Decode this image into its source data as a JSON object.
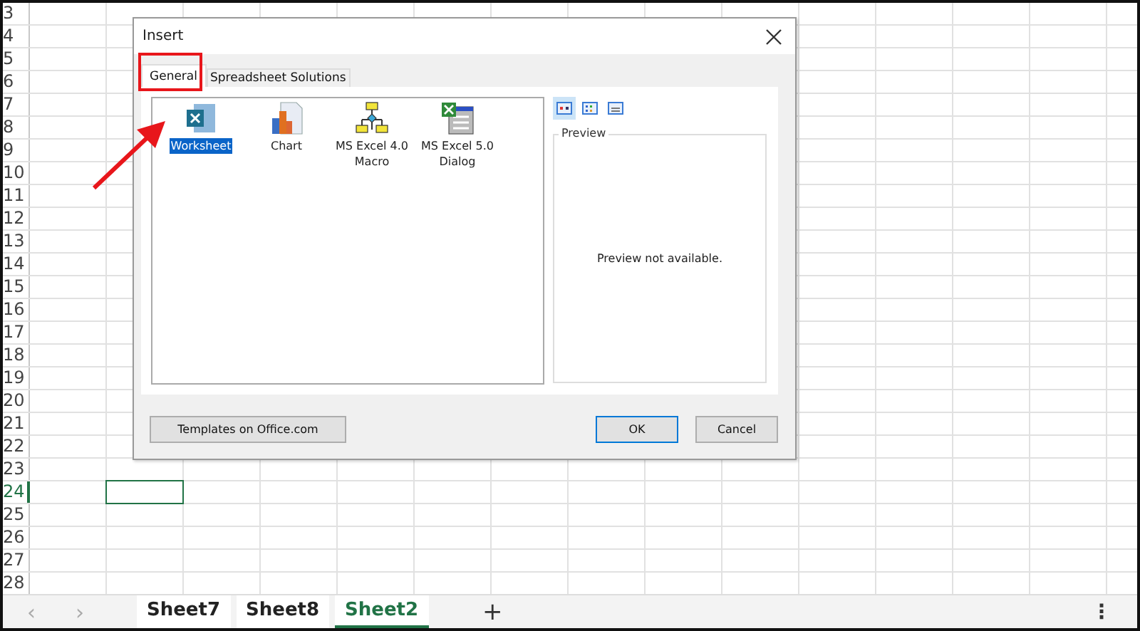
{
  "rows": [
    {
      "label": "3",
      "selected": false
    },
    {
      "label": "4",
      "selected": false
    },
    {
      "label": "5",
      "selected": false
    },
    {
      "label": "6",
      "selected": false
    },
    {
      "label": "7",
      "selected": false
    },
    {
      "label": "8",
      "selected": false
    },
    {
      "label": "9",
      "selected": false
    },
    {
      "label": "10",
      "selected": false
    },
    {
      "label": "11",
      "selected": false
    },
    {
      "label": "12",
      "selected": false
    },
    {
      "label": "13",
      "selected": false
    },
    {
      "label": "14",
      "selected": false
    },
    {
      "label": "15",
      "selected": false
    },
    {
      "label": "16",
      "selected": false
    },
    {
      "label": "17",
      "selected": false
    },
    {
      "label": "18",
      "selected": false
    },
    {
      "label": "19",
      "selected": false
    },
    {
      "label": "20",
      "selected": false
    },
    {
      "label": "21",
      "selected": false
    },
    {
      "label": "22",
      "selected": false
    },
    {
      "label": "23",
      "selected": false
    },
    {
      "label": "24",
      "selected": true
    },
    {
      "label": "25",
      "selected": false
    },
    {
      "label": "26",
      "selected": false
    },
    {
      "label": "27",
      "selected": false
    },
    {
      "label": "28",
      "selected": false
    }
  ],
  "dialog": {
    "title": "Insert",
    "tabs": [
      {
        "label": "General",
        "selected": true
      },
      {
        "label": "Spreadsheet Solutions",
        "selected": false
      }
    ],
    "items": [
      {
        "kind": "worksheet",
        "label": "Worksheet",
        "selected": true
      },
      {
        "kind": "chart",
        "label": "Chart",
        "selected": false
      },
      {
        "kind": "macro",
        "label": "MS Excel 4.0 Macro",
        "selected": false
      },
      {
        "kind": "dialog",
        "label": "MS Excel 5.0 Dialog",
        "selected": false
      }
    ],
    "views": [
      {
        "kind": "large",
        "selected": true
      },
      {
        "kind": "list",
        "selected": false
      },
      {
        "kind": "details",
        "selected": false
      }
    ],
    "preview": {
      "title": "Preview",
      "message": "Preview not available."
    },
    "buttons": [
      {
        "kind": "templates",
        "label": "Templates on Office.com"
      },
      {
        "kind": "ok",
        "label": "OK"
      },
      {
        "kind": "cancel",
        "label": "Cancel"
      }
    ]
  },
  "sheet_tabs": [
    {
      "label": "Sheet7",
      "selected": false
    },
    {
      "label": "Sheet8",
      "selected": false
    },
    {
      "label": "Sheet2",
      "selected": true
    }
  ],
  "add_sheet": "+",
  "more": "⋮",
  "nav": [
    "‹",
    "›"
  ]
}
